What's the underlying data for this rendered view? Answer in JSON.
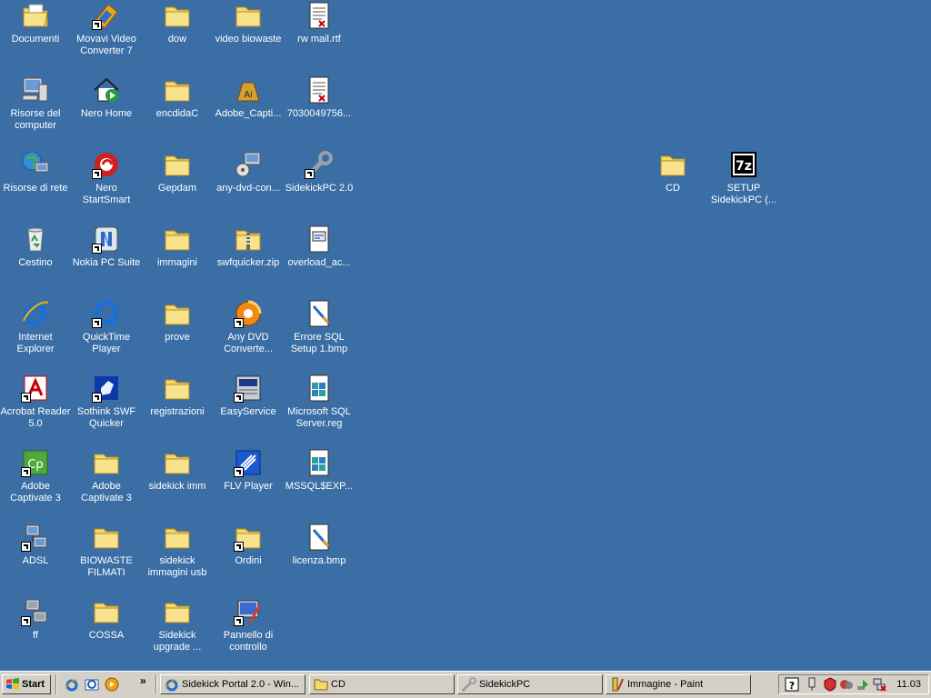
{
  "desktop": {
    "icons": [
      {
        "label": "Documenti"
      },
      {
        "label": "Risorse del computer"
      },
      {
        "label": "Risorse di rete"
      },
      {
        "label": "Cestino"
      },
      {
        "label": "Internet Explorer"
      },
      {
        "label": "Acrobat Reader 5.0"
      },
      {
        "label": "Adobe Captivate 3"
      },
      {
        "label": "ADSL"
      },
      {
        "label": "ff"
      },
      {
        "label": "Movavi Video Converter 7"
      },
      {
        "label": "Nero Home"
      },
      {
        "label": "Nero StartSmart"
      },
      {
        "label": "Nokia PC Suite"
      },
      {
        "label": "QuickTime Player"
      },
      {
        "label": "Sothink SWF Quicker"
      },
      {
        "label": "Adobe Captivate 3"
      },
      {
        "label": "BIOWASTE FILMATI"
      },
      {
        "label": "COSSA"
      },
      {
        "label": "dow"
      },
      {
        "label": "encdidaC"
      },
      {
        "label": "Gepdam"
      },
      {
        "label": "immagini"
      },
      {
        "label": "prove"
      },
      {
        "label": "registrazioni"
      },
      {
        "label": "sidekick imm"
      },
      {
        "label": "sidekick immagini usb"
      },
      {
        "label": "Sidekick upgrade ..."
      },
      {
        "label": "video biowaste"
      },
      {
        "label": "Adobe_Capti..."
      },
      {
        "label": "any-dvd-con..."
      },
      {
        "label": "swfquicker.zip"
      },
      {
        "label": "Any DVD Converte..."
      },
      {
        "label": "EasyService"
      },
      {
        "label": "FLV Player"
      },
      {
        "label": "Ordini"
      },
      {
        "label": "Pannello di controllo"
      },
      {
        "label": "rw mail.rtf"
      },
      {
        "label": "7030049756..."
      },
      {
        "label": "SidekickPC 2.0"
      },
      {
        "label": "overload_ac..."
      },
      {
        "label": "Errore SQL Setup 1.bmp"
      },
      {
        "label": "Microsoft SQL Server.reg"
      },
      {
        "label": "MSSQL$EXP..."
      },
      {
        "label": "licenza.bmp"
      },
      {
        "label": "CD"
      },
      {
        "label": "SETUP SidekickPC (..."
      }
    ]
  },
  "taskbar": {
    "start_label": "Start",
    "quicklaunch_more": "»",
    "tasks": [
      {
        "label": "Sidekick Portal 2.0 - Win..."
      },
      {
        "label": "CD"
      },
      {
        "label": "SidekickPC"
      },
      {
        "label": "Immagine - Paint"
      }
    ],
    "clock": "11.03"
  },
  "colors": {
    "desktop": "#3a6ea5",
    "taskbar": "#d4d0c8",
    "folder": "#f6d86a"
  }
}
